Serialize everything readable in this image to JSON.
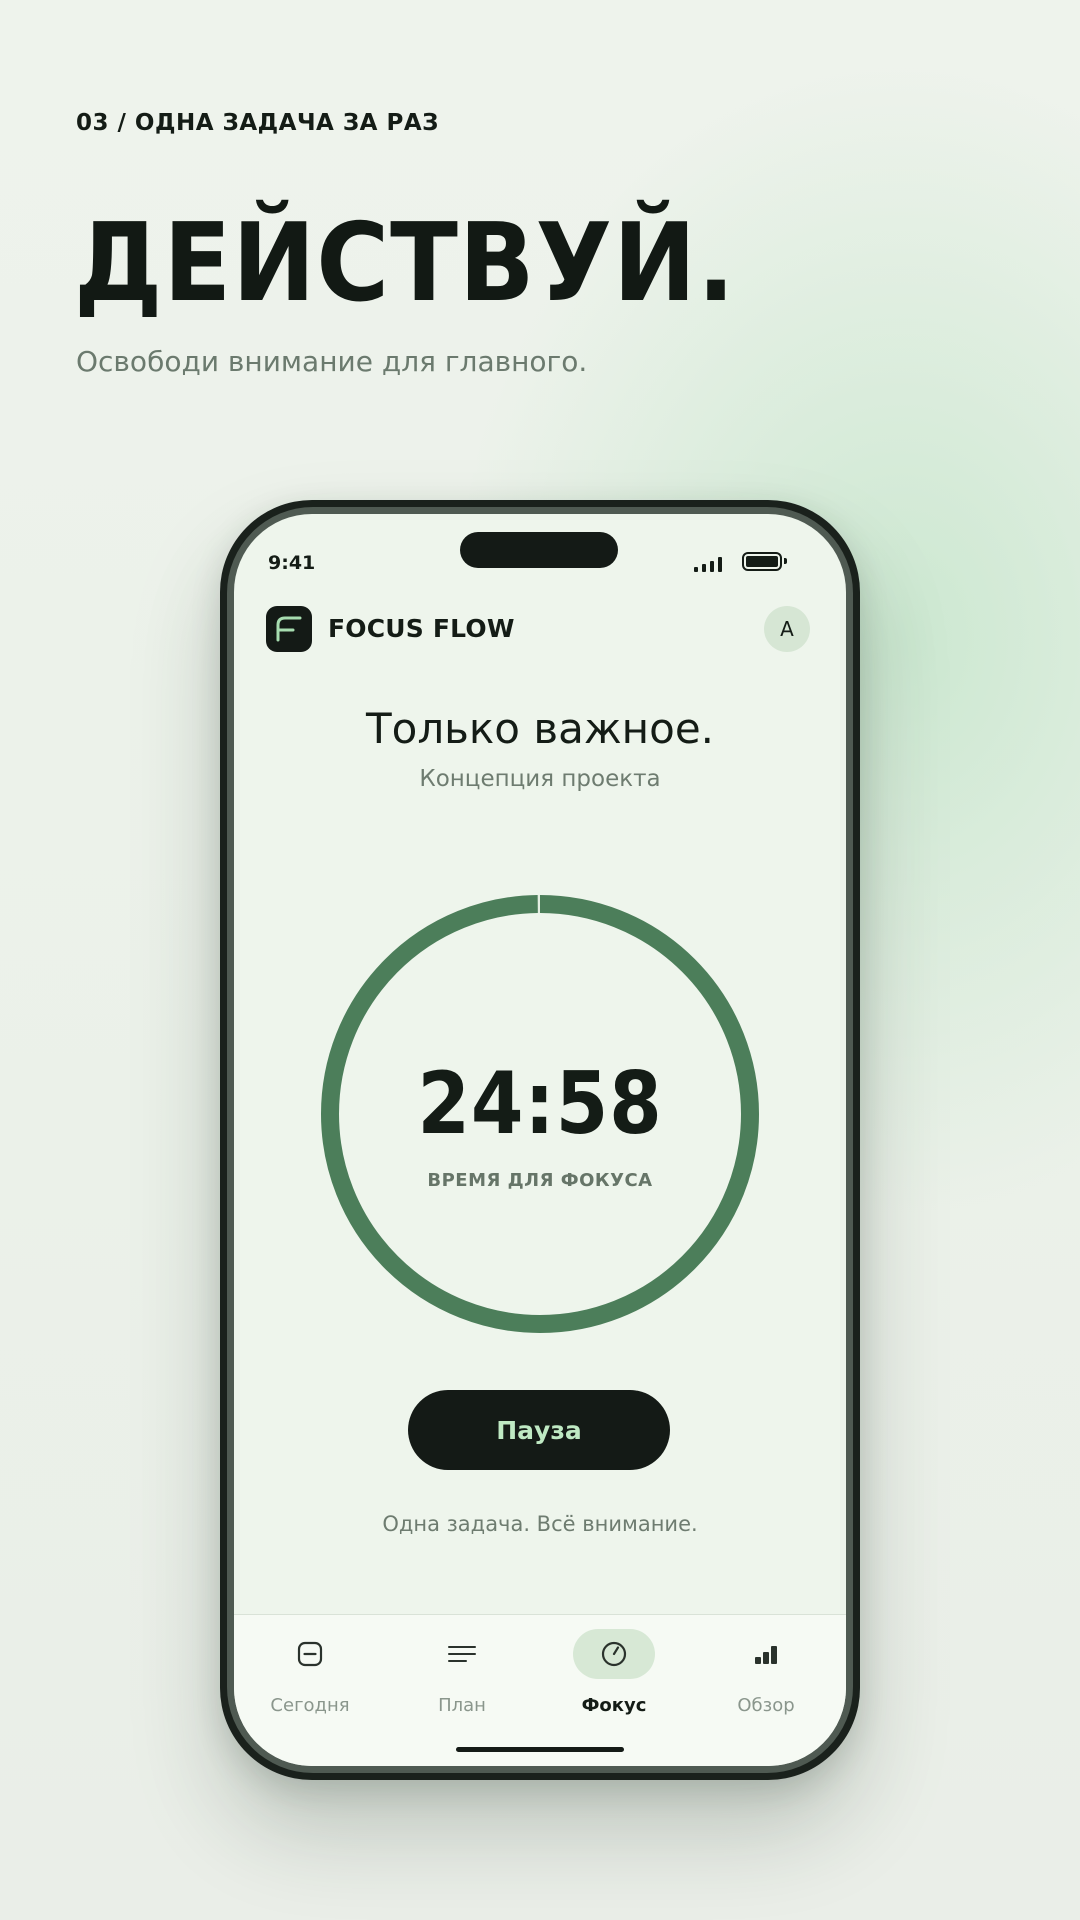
{
  "hero": {
    "eyebrow": "03 / ОДНА ЗАДАЧА ЗА РАЗ",
    "headline": "ДЕЙСТВУЙ.",
    "subhead": "Освободи внимание для главного."
  },
  "status_bar": {
    "time": "9:41"
  },
  "app": {
    "name": "FOCUS FLOW",
    "avatar_initial": "A",
    "logo_icon": "f-logo-icon"
  },
  "focus": {
    "title": "Только важное.",
    "subtitle": "Концепция проекта",
    "timer": "24:58",
    "timer_label": "ВРЕМЯ ДЛЯ ФОКУСА",
    "progress": 0.998,
    "pause_label": "Пауза",
    "motto": "Одна задача. Всё внимание."
  },
  "tabs": [
    {
      "label": "Сегодня",
      "icon": "today-icon",
      "active": false
    },
    {
      "label": "План",
      "icon": "plan-icon",
      "active": false
    },
    {
      "label": "Фокус",
      "icon": "timer-icon",
      "active": true
    },
    {
      "label": "Обзор",
      "icon": "chart-icon",
      "active": false
    }
  ],
  "colors": {
    "accent": "#4c7e5a",
    "ring_track": "#e4eee2",
    "dark": "#141a16",
    "button_text": "#bfe9c3",
    "background": "#eef5ec"
  }
}
